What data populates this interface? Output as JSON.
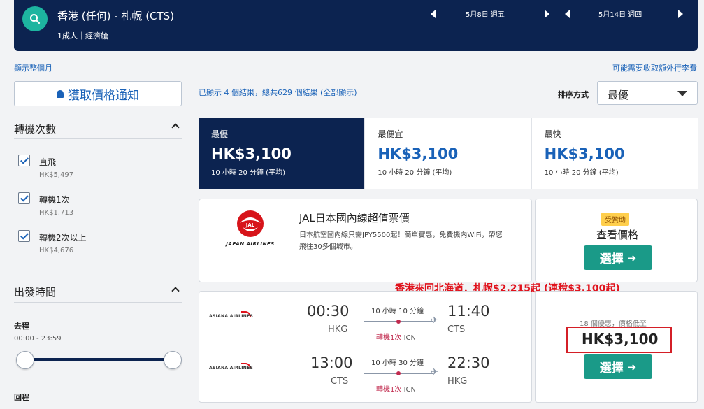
{
  "header": {
    "route": "香港 (任何) - 札幌 (CTS)",
    "passengers": "1成人｜經濟艙",
    "depart_date": "5月8日 週五",
    "return_date": "5月14日 週四"
  },
  "links": {
    "show_month": "顯示整個月",
    "fees_notice": "可能需要收取額外行李費"
  },
  "sidebar": {
    "price_alert": "獲取價格通知",
    "stops_title": "轉機次數",
    "stops": [
      {
        "label": "直飛",
        "price": "HK$5,497"
      },
      {
        "label": "轉機1次",
        "price": "HK$1,713"
      },
      {
        "label": "轉機2次以上",
        "price": "HK$4,676"
      }
    ],
    "time_title": "出發時間",
    "outbound_label": "去程",
    "outbound_range": "00:00 - 23:59",
    "return_label": "回程"
  },
  "results": {
    "summary": "已顯示 4 個結果，總共629 個結果 (全部顯示)",
    "sort_label": "排序方式",
    "sort_value": "最優"
  },
  "tabs": [
    {
      "name": "最優",
      "price": "HK$3,100",
      "duration": "10 小時 20 分鐘 (平均)"
    },
    {
      "name": "最便宜",
      "price": "HK$3,100",
      "duration": "10 小時 20 分鐘 (平均)"
    },
    {
      "name": "最快",
      "price": "HK$3,100",
      "duration": "10 小時 20 分鐘 (平均)"
    }
  ],
  "ad": {
    "brand": "JAPAN AIRLINES",
    "title": "JAL日本國內線超值票價",
    "desc": "日本航空國內線只需JPY5500起！簡單實惠，免費機內WiFi，帶您飛往30多個城市。",
    "badge": "受贊助",
    "cta_title": "查看價格",
    "cta_button": "選擇"
  },
  "promo_text": "香港來回北海道．札幌$2,215起 (連稅$3,100起)",
  "flight": {
    "airline": "ASIANA AIRLINES",
    "legs": [
      {
        "dep_time": "00:30",
        "dep_code": "HKG",
        "duration": "10 小時 10 分鐘",
        "stops": "轉機1次",
        "via": "ICN",
        "arr_time": "11:40",
        "arr_code": "CTS"
      },
      {
        "dep_time": "13:00",
        "dep_code": "CTS",
        "duration": "10 小時 30 分鐘",
        "stops": "轉機1次",
        "via": "ICN",
        "arr_time": "22:30",
        "arr_code": "HKG"
      }
    ],
    "deals": "18 個優惠，價格低至",
    "price": "HK$3,100",
    "button": "選擇"
  }
}
